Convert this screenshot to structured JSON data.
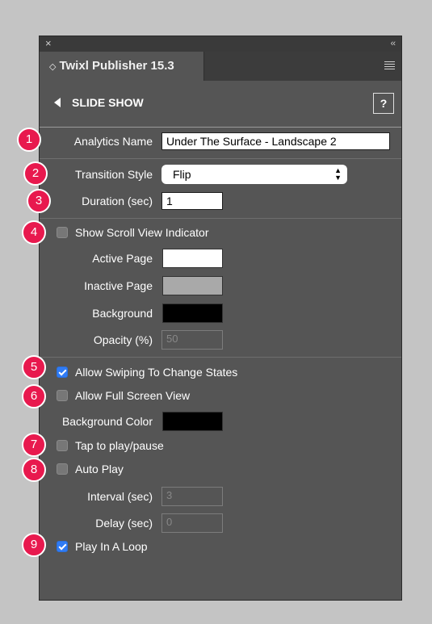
{
  "window": {
    "close_glyph": "×",
    "collapse_glyph": "‹‹",
    "tab_title": "Twixl Publisher 15.3",
    "tab_sort_glyph": "◇"
  },
  "header": {
    "title": "SLIDE SHOW",
    "help_label": "?"
  },
  "badges": [
    "1",
    "2",
    "3",
    "4",
    "5",
    "6",
    "7",
    "8",
    "9"
  ],
  "fields": {
    "analytics_name_label": "Analytics Name",
    "analytics_name_value": "Under The Surface - Landscape 2",
    "transition_style_label": "Transition Style",
    "transition_style_value": "Flip",
    "duration_label": "Duration (sec)",
    "duration_value": "1",
    "show_scroll_label": "Show Scroll View Indicator",
    "show_scroll_checked": false,
    "active_page_label": "Active Page",
    "active_page_color": "#ffffff",
    "inactive_page_label": "Inactive Page",
    "inactive_page_color": "#a9a9a9",
    "background_label": "Background",
    "background_color": "#000000",
    "opacity_label": "Opacity (%)",
    "opacity_value": "50",
    "allow_swiping_label": "Allow Swiping To Change States",
    "allow_swiping_checked": true,
    "allow_fullscreen_label": "Allow Full Screen View",
    "allow_fullscreen_checked": false,
    "bg_color_label": "Background Color",
    "bg_color_value": "#000000",
    "tap_play_label": "Tap to play/pause",
    "tap_play_checked": false,
    "auto_play_label": "Auto Play",
    "auto_play_checked": false,
    "interval_label": "Interval (sec)",
    "interval_value": "3",
    "delay_label": "Delay (sec)",
    "delay_value": "0",
    "loop_label": "Play In A Loop",
    "loop_checked": true
  },
  "colors": {
    "badge": "#e8194e",
    "checkbox_on": "#2f7bf5",
    "panel": "#555555"
  }
}
